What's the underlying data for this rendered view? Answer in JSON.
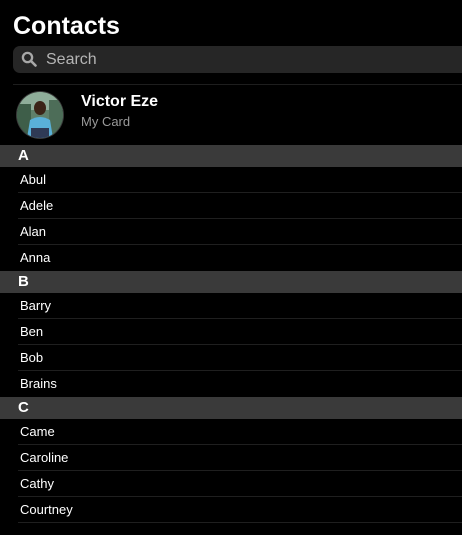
{
  "header": {
    "title": "Contacts"
  },
  "search": {
    "placeholder": "Search",
    "icon": "search-icon"
  },
  "my_card": {
    "name": "Victor Eze",
    "subtitle": "My Card"
  },
  "sections": [
    {
      "letter": "A",
      "contacts": [
        "Abul",
        "Adele",
        "Alan",
        "Anna"
      ]
    },
    {
      "letter": "B",
      "contacts": [
        "Barry",
        "Ben",
        "Bob",
        "Brains"
      ]
    },
    {
      "letter": "C",
      "contacts": [
        "Came",
        "Caroline",
        "Cathy",
        "Courtney"
      ]
    }
  ],
  "colors": {
    "background": "#000000",
    "section_header": "#3a3a3a",
    "search_field": "#262626",
    "secondary_text": "#9a9a9a"
  }
}
